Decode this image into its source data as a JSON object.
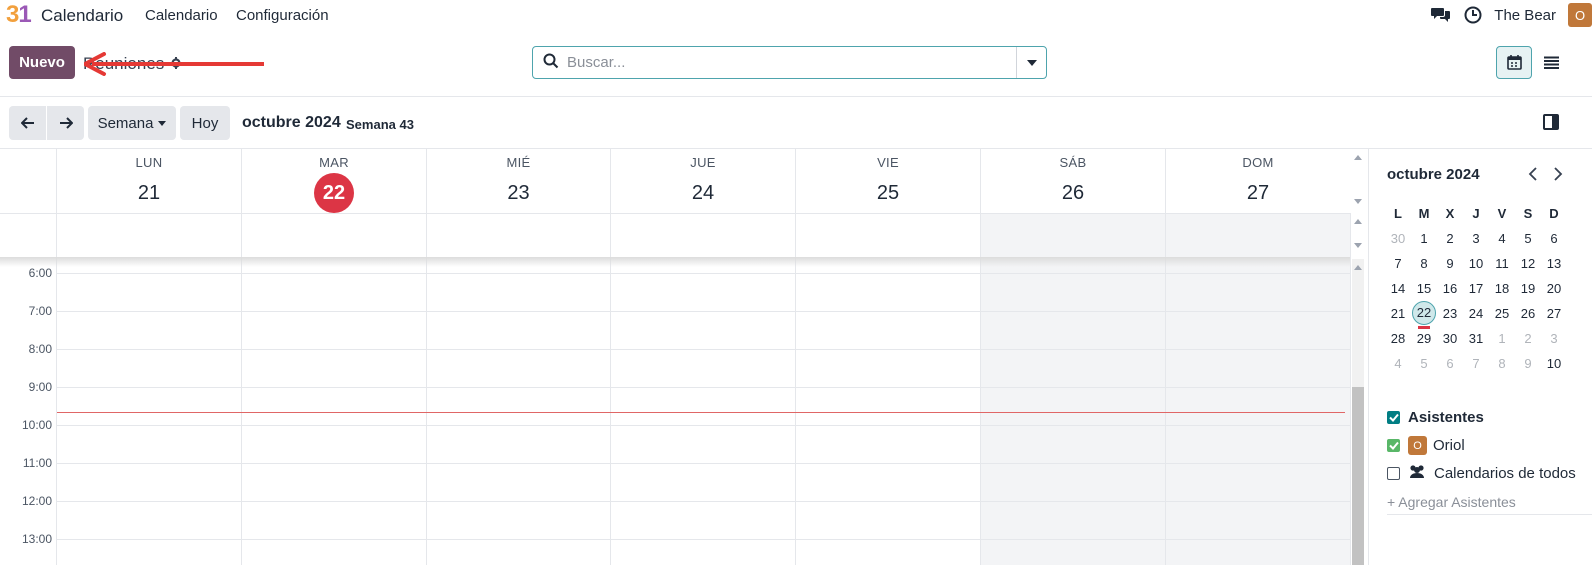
{
  "navbar": {
    "logo_text": "31",
    "app_name": "Calendario",
    "menu": [
      "Calendario",
      "Configuración"
    ],
    "user_name": "The Bear",
    "user_initial": "O",
    "icons": [
      "chat-icon",
      "clock-icon"
    ]
  },
  "control": {
    "new_label": "Nuevo",
    "breadcrumb": "Reuniones",
    "search_placeholder": "Buscar...",
    "views": [
      "calendar-view",
      "list-view"
    ]
  },
  "toolbar": {
    "scale_label": "Semana",
    "today_label": "Hoy",
    "period": "octubre 2024",
    "week": "Semana 43"
  },
  "week": {
    "days": [
      {
        "dow": "LUN",
        "num": "21"
      },
      {
        "dow": "MAR",
        "num": "22",
        "today": true
      },
      {
        "dow": "MIÉ",
        "num": "23"
      },
      {
        "dow": "JUE",
        "num": "24"
      },
      {
        "dow": "VIE",
        "num": "25"
      },
      {
        "dow": "SÁB",
        "num": "26",
        "weekend": true
      },
      {
        "dow": "DOM",
        "num": "27",
        "weekend": true
      }
    ],
    "hours": [
      "6:00",
      "7:00",
      "8:00",
      "9:00",
      "10:00",
      "11:00",
      "12:00",
      "13:00"
    ]
  },
  "mini": {
    "title": "octubre 2024",
    "headers": [
      "L",
      "M",
      "X",
      "J",
      "V",
      "S",
      "D"
    ],
    "weeks": [
      [
        "30",
        "1",
        "2",
        "3",
        "4",
        "5",
        "6"
      ],
      [
        "7",
        "8",
        "9",
        "10",
        "11",
        "12",
        "13"
      ],
      [
        "14",
        "15",
        "16",
        "17",
        "18",
        "19",
        "20"
      ],
      [
        "21",
        "22",
        "23",
        "24",
        "25",
        "26",
        "27"
      ],
      [
        "28",
        "29",
        "30",
        "31",
        "1",
        "2",
        "3"
      ],
      [
        "4",
        "5",
        "6",
        "7",
        "8",
        "9",
        "10"
      ]
    ],
    "selected": "22"
  },
  "filters": {
    "section_label": "Asistentes",
    "attendee": "Oriol",
    "attendee_initial": "O",
    "everyone": "Calendarios de todos",
    "add_label": "+ Agregar Asistentes"
  },
  "colors": {
    "primary": "#714b67",
    "accent": "#017e84",
    "today": "#dc3545"
  }
}
